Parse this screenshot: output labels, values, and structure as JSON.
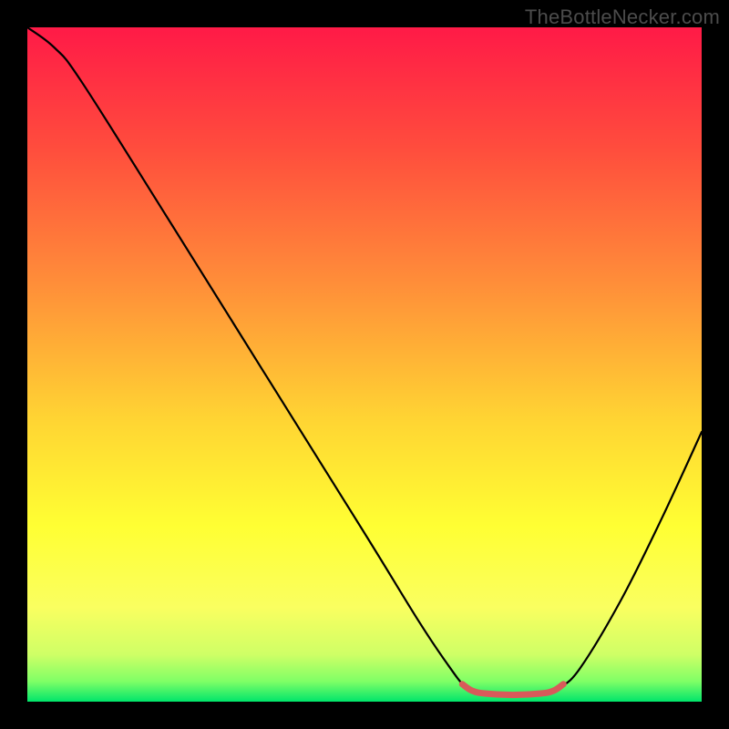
{
  "watermark": "TheBottleNecker.com",
  "chart_data": {
    "type": "line",
    "title": "",
    "xlabel": "",
    "ylabel": "",
    "xlim": [
      0,
      100
    ],
    "ylim": [
      0,
      100
    ],
    "gradient_stops": [
      {
        "offset": 0,
        "color": "#ff1a47"
      },
      {
        "offset": 0.18,
        "color": "#ff4d3d"
      },
      {
        "offset": 0.38,
        "color": "#ff8e39"
      },
      {
        "offset": 0.58,
        "color": "#ffd433"
      },
      {
        "offset": 0.74,
        "color": "#ffff33"
      },
      {
        "offset": 0.86,
        "color": "#faff60"
      },
      {
        "offset": 0.93,
        "color": "#cfff66"
      },
      {
        "offset": 0.97,
        "color": "#7fff66"
      },
      {
        "offset": 1.0,
        "color": "#00e56b"
      }
    ],
    "series": [
      {
        "name": "bottleneck-curve",
        "stroke": "#000000",
        "stroke_width": 2.2,
        "points": [
          {
            "x": 0,
            "y": 100
          },
          {
            "x": 4,
            "y": 97
          },
          {
            "x": 8,
            "y": 92
          },
          {
            "x": 20,
            "y": 73
          },
          {
            "x": 35,
            "y": 49
          },
          {
            "x": 50,
            "y": 25
          },
          {
            "x": 58,
            "y": 12
          },
          {
            "x": 62,
            "y": 6
          },
          {
            "x": 65,
            "y": 2.1
          },
          {
            "x": 67,
            "y": 1.3
          },
          {
            "x": 70,
            "y": 1.0
          },
          {
            "x": 74,
            "y": 1.0
          },
          {
            "x": 77,
            "y": 1.3
          },
          {
            "x": 79,
            "y": 2.1
          },
          {
            "x": 82,
            "y": 5
          },
          {
            "x": 88,
            "y": 15
          },
          {
            "x": 94,
            "y": 27
          },
          {
            "x": 100,
            "y": 40
          }
        ]
      },
      {
        "name": "optimal-zone-marker",
        "stroke": "#d85a5a",
        "stroke_width": 7,
        "cap": "round",
        "points": [
          {
            "x": 64.5,
            "y": 2.6
          },
          {
            "x": 66,
            "y": 1.6
          },
          {
            "x": 68,
            "y": 1.2
          },
          {
            "x": 72,
            "y": 1.0
          },
          {
            "x": 76,
            "y": 1.2
          },
          {
            "x": 78,
            "y": 1.6
          },
          {
            "x": 79.5,
            "y": 2.6
          }
        ]
      }
    ]
  }
}
